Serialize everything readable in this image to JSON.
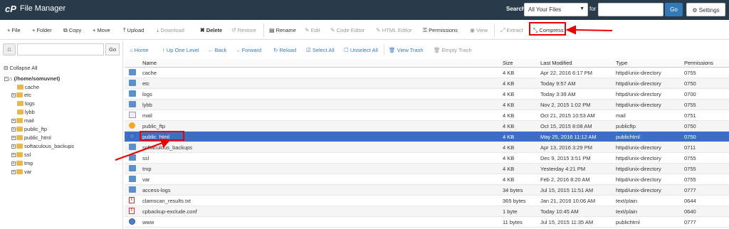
{
  "app": {
    "logo": "cP",
    "title": "File Manager"
  },
  "search": {
    "label": "Search",
    "scope": "All Your Files",
    "for_label": "for",
    "go_label": "Go",
    "settings_label": "Settings"
  },
  "toolbar": {
    "file": "+ File",
    "folder": "+ Folder",
    "copy": "Copy",
    "move": "+ Move",
    "upload": "Upload",
    "download": "Download",
    "delete": "Delete",
    "restore": "Restore",
    "rename": "Rename",
    "edit": "Edit",
    "code_editor": "Code Editor",
    "html_editor": "HTML Editor",
    "permissions": "Permissions",
    "view": "View",
    "extract": "Extract",
    "compress": "Compress"
  },
  "left": {
    "go_label": "Go",
    "collapse_label": "Collapse All",
    "root": "(/home/somuvnet)",
    "tree": [
      "cache",
      "etc",
      "logs",
      "lybb",
      "mail",
      "public_ftp",
      "public_html",
      "softaculous_backups",
      "ssl",
      "tmp",
      "var"
    ]
  },
  "nav": {
    "home": "Home",
    "up": "Up One Level",
    "back": "Back",
    "forward": "Forward",
    "reload": "Reload",
    "select_all": "Select All",
    "unselect_all": "Unselect All",
    "view_trash": "View Trash",
    "empty_trash": "Empty Trash"
  },
  "table": {
    "headers": {
      "name": "Name",
      "size": "Size",
      "modified": "Last Modified",
      "type": "Type",
      "perms": "Permissions"
    },
    "rows": [
      {
        "icon": "folder-icon",
        "name": "cache",
        "size": "4 KB",
        "modified": "Apr 22, 2016 6:17 PM",
        "type": "httpd/unix-directory",
        "perms": "0755"
      },
      {
        "icon": "folder-icon",
        "name": "etc",
        "size": "4 KB",
        "modified": "Today 9:57 AM",
        "type": "httpd/unix-directory",
        "perms": "0750"
      },
      {
        "icon": "folder-icon",
        "name": "logs",
        "size": "4 KB",
        "modified": "Today 3:39 AM",
        "type": "httpd/unix-directory",
        "perms": "0700"
      },
      {
        "icon": "folder-icon",
        "name": "lybb",
        "size": "4 KB",
        "modified": "Nov 2, 2015 1:02 PM",
        "type": "httpd/unix-directory",
        "perms": "0755"
      },
      {
        "icon": "mail-icon",
        "name": "mail",
        "size": "4 KB",
        "modified": "Oct 21, 2015 10:53 AM",
        "type": "mail",
        "perms": "0751"
      },
      {
        "icon": "ftp-icon",
        "name": "public_ftp",
        "size": "4 KB",
        "modified": "Oct 15, 2015 8:08 AM",
        "type": "publicftp",
        "perms": "0750"
      },
      {
        "icon": "web-icon",
        "name": "public_html",
        "size": "4 KB",
        "modified": "May 25, 2016 11:12 AM",
        "type": "publichtml",
        "perms": "0750"
      },
      {
        "icon": "folder-icon",
        "name": "softaculous_backups",
        "size": "4 KB",
        "modified": "Apr 13, 2016 3:29 PM",
        "type": "httpd/unix-directory",
        "perms": "0711"
      },
      {
        "icon": "folder-icon",
        "name": "ssl",
        "size": "4 KB",
        "modified": "Dec 9, 2015 3:51 PM",
        "type": "httpd/unix-directory",
        "perms": "0755"
      },
      {
        "icon": "folder-icon",
        "name": "tmp",
        "size": "4 KB",
        "modified": "Yesterday 4:21 PM",
        "type": "httpd/unix-directory",
        "perms": "0755"
      },
      {
        "icon": "folder-icon",
        "name": "var",
        "size": "4 KB",
        "modified": "Feb 2, 2016 8:20 AM",
        "type": "httpd/unix-directory",
        "perms": "0755"
      },
      {
        "icon": "folder-icon",
        "name": "access-logs",
        "size": "34 bytes",
        "modified": "Jul 15, 2015 11:51 AM",
        "type": "httpd/unix-directory",
        "perms": "0777"
      },
      {
        "icon": "text-icon",
        "name": "clamscan_results.txt",
        "size": "365 bytes",
        "modified": "Jan 21, 2016 10:06 AM",
        "type": "text/plain",
        "perms": "0644"
      },
      {
        "icon": "text-icon",
        "name": "cpbackup-exclude.conf",
        "size": "1 byte",
        "modified": "Today 10:45 AM",
        "type": "text/plain",
        "perms": "0640"
      },
      {
        "icon": "web-icon",
        "name": "www",
        "size": "11 bytes",
        "modified": "Jul 15, 2015 11:35 AM",
        "type": "publichtml",
        "perms": "0777"
      }
    ],
    "selected_row": "public_html"
  },
  "colors": {
    "topbar": "#293a4a",
    "accent": "#337ab7",
    "selected_row": "#3d6fc0",
    "annotation": "#e00000",
    "folder": "#5b8fce"
  }
}
